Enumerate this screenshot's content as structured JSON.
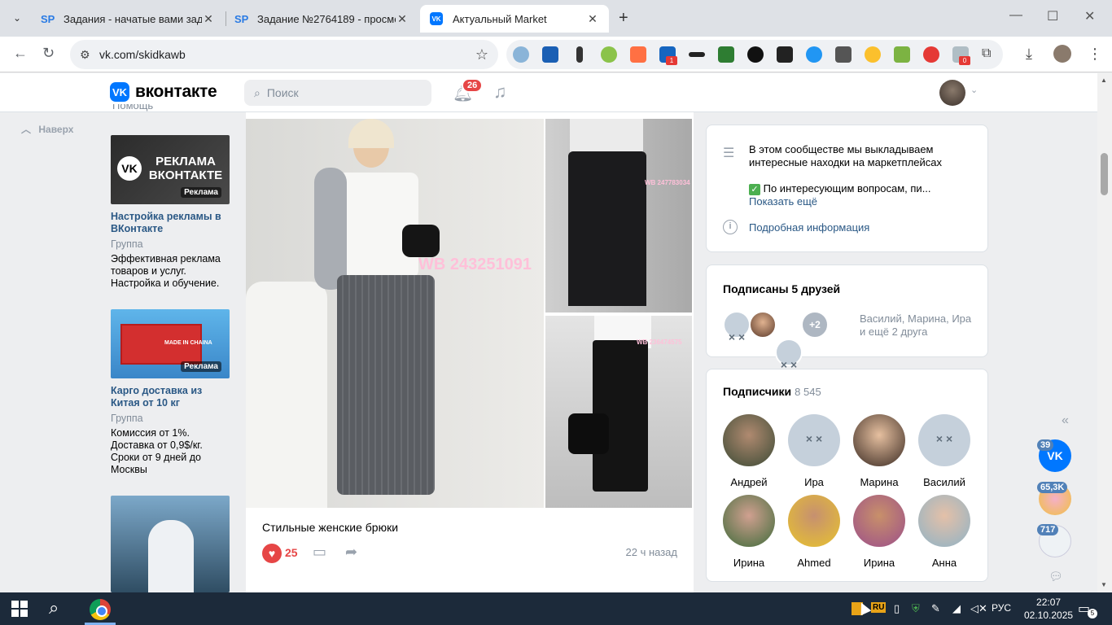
{
  "browser": {
    "tabs": [
      {
        "favicon": "SP",
        "title": "Задания - начатые вами задан"
      },
      {
        "favicon": "SP",
        "title": "Задание №2764189 - просмот"
      },
      {
        "favicon": "VK",
        "title": "Актуальный Market"
      }
    ],
    "url": "vk.com/skidkawb",
    "ext_badges": [
      "1",
      "0"
    ]
  },
  "vk": {
    "logo_text": "вконтакте",
    "search_placeholder": "Поиск",
    "notifications_count": "26",
    "back_to_top": "Наверх",
    "partial_menu_item": "Помощь"
  },
  "ads": [
    {
      "image_text": "РЕКЛАМА ВКОНТАКТЕ",
      "badge": "Реклама",
      "title": "Настройка рекламы в ВКонтакте",
      "type": "Группа",
      "description": "Эффективная реклама товаров и услуг. Настройка и обучение."
    },
    {
      "image_text": "MADE IN CHAINA",
      "badge": "Реклама",
      "title": "Карго доставка из Китая от 10 кг",
      "type": "Группа",
      "description": "Комиссия от 1%. Доставка от 0,9$/кг. Сроки от 9 дней до Москвы"
    },
    {
      "image_text": "",
      "badge": "",
      "title": "",
      "type": "",
      "description": ""
    }
  ],
  "post": {
    "photo_labels": [
      "WB 243251091",
      "WB 247783034",
      "WB 236474575"
    ],
    "caption": "Стильные женские брюки",
    "likes": "25",
    "time": "22 ч назад"
  },
  "community_info": {
    "description": "В этом сообществе мы выкладываем интересные находки на маркетплейсах",
    "note": "По интересующим вопросам, пи...",
    "show_more": "Показать ещё",
    "details_link": "Подробная информация"
  },
  "friends": {
    "title": "Подписаны 5 друзей",
    "extra_count": "+2",
    "names_line1": "Василий, Марина, Ира",
    "names_line2": "и ещё 2 друга"
  },
  "subscribers": {
    "title": "Подписчики",
    "count": "8 545",
    "people": [
      "Андрей",
      "Ира",
      "Марина",
      "Василий",
      "Ирина",
      "Ahmed",
      "Ирина",
      "Анна"
    ]
  },
  "mini_sidebar": {
    "badges": [
      "39",
      "65,3K",
      "717"
    ]
  },
  "taskbar": {
    "lang": "РУС",
    "lang_badge": "RU",
    "time": "22:07",
    "date": "02.10.2025",
    "notifications": "5"
  },
  "colors": {
    "vk_blue": "#0077ff",
    "link": "#2a5885",
    "like_red": "#e64646",
    "page_bg": "#edeef0",
    "wb_label": "#ffc0d9"
  },
  "icons": [
    "tab-list-icon",
    "close-icon",
    "plus-icon",
    "back-arrow-icon",
    "reload-icon",
    "site-settings-icon",
    "star-icon",
    "extensions-puzzle-icon",
    "download-icon",
    "profile-icon",
    "menu-dots-icon",
    "search-icon",
    "bell-icon",
    "music-icon",
    "chevron-up-icon",
    "heart-icon",
    "comment-icon",
    "share-icon",
    "info-icon",
    "lines-icon",
    "checkmark-icon",
    "double-chevron-left-icon",
    "chat-icon",
    "windows-start-icon",
    "chrome-icon"
  ]
}
